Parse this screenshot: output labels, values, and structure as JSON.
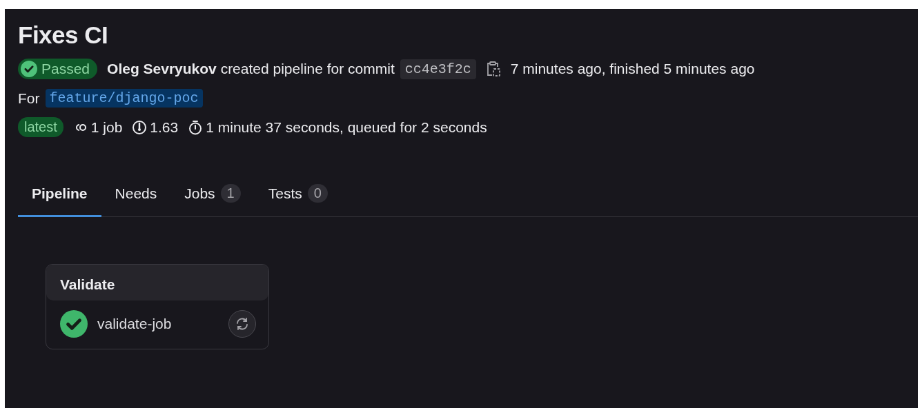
{
  "title": "Fixes CI",
  "status": {
    "label": "Passed",
    "kind": "success"
  },
  "summary": "**Oleg Sevryukov** created pipeline for commit",
  "commit": "cc4e3f2c",
  "timing": "7 minutes ago, finished 5 minutes ago",
  "ref_prefix": "For",
  "ref": "feature/django-poc",
  "badges": [
    {
      "label": "latest"
    }
  ],
  "stats": [
    {
      "kind": "jobs",
      "text": "1 job"
    },
    {
      "kind": "compute",
      "text": "1.63"
    },
    {
      "kind": "duration",
      "text": "1 minute 37 seconds, queued for 2 seconds"
    }
  ],
  "tabs": [
    {
      "label": "Pipeline",
      "selected": true
    },
    {
      "label": "Needs",
      "selected": false
    },
    {
      "label": "Jobs",
      "count": "1",
      "selected": false
    },
    {
      "label": "Tests",
      "count": "0",
      "selected": false
    }
  ],
  "stages": [
    {
      "name": "Validate",
      "jobs": [
        {
          "name": "validate-job",
          "kind": "success"
        }
      ]
    }
  ]
}
